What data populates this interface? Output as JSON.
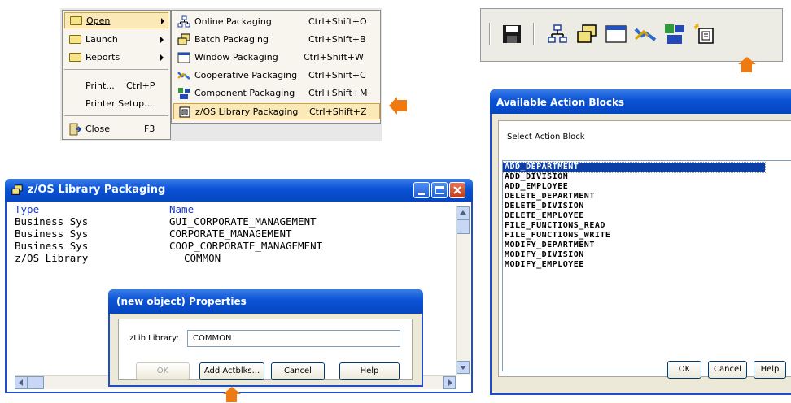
{
  "colors": {
    "accent_orange": "#f07a12",
    "xp_title_blue": "#0a52d6",
    "selection_blue": "#0b3fa5",
    "menu_highlight": "#fbe9b7"
  },
  "file_menu": {
    "items": [
      {
        "label": "Open",
        "icon": "folder-icon",
        "submenu": true
      },
      {
        "label": "Launch",
        "icon": "folder-icon",
        "submenu": true
      },
      {
        "label": "Reports",
        "icon": "folder-icon",
        "submenu": true
      },
      {
        "label": "Print...",
        "shortcut": "Ctrl+P"
      },
      {
        "label": "Printer Setup..."
      },
      {
        "label": "Close",
        "shortcut": "F3",
        "icon": "close-door-icon"
      }
    ]
  },
  "open_submenu": {
    "items": [
      {
        "label": "Online Packaging",
        "shortcut": "Ctrl+Shift+O",
        "icon": "online-packaging-icon"
      },
      {
        "label": "Batch Packaging",
        "shortcut": "Ctrl+Shift+B",
        "icon": "batch-packaging-icon"
      },
      {
        "label": "Window Packaging",
        "shortcut": "Ctrl+Shift+W",
        "icon": "window-packaging-icon"
      },
      {
        "label": "Cooperative Packaging",
        "shortcut": "Ctrl+Shift+C",
        "icon": "cooperative-packaging-icon"
      },
      {
        "label": "Component Packaging",
        "shortcut": "Ctrl+Shift+M",
        "icon": "component-packaging-icon"
      },
      {
        "label": "z/OS Library Packaging",
        "shortcut": "Ctrl+Shift+Z",
        "icon": "zos-library-icon",
        "highlighted": true
      }
    ]
  },
  "toolbar": {
    "buttons": [
      "save-icon",
      "online-packaging-icon",
      "batch-packaging-icon",
      "window-packaging-icon",
      "cooperative-packaging-icon",
      "component-packaging-icon",
      "zos-library-icon"
    ]
  },
  "zos_window": {
    "title": "z/OS Library Packaging",
    "columns": [
      "Type",
      "Name"
    ],
    "rows": [
      [
        "Business Sys",
        "GUI_CORPORATE_MANAGEMENT"
      ],
      [
        "Business Sys",
        "CORPORATE_MANAGEMENT"
      ],
      [
        "Business Sys",
        "COOP_CORPORATE_MANAGEMENT"
      ],
      [
        "z/OS Library",
        "COMMON"
      ]
    ]
  },
  "properties_dialog": {
    "title": "(new object) Properties",
    "field_label": "zLib Library:",
    "field_value": "COMMON",
    "buttons": {
      "ok": "OK",
      "add": "Add Actblks...",
      "cancel": "Cancel",
      "help": "Help"
    }
  },
  "action_blocks_dialog": {
    "title": "Available Action Blocks",
    "prompt": "Select Action Block",
    "items": [
      "ADD_DEPARTMENT",
      "ADD_DIVISION",
      "ADD_EMPLOYEE",
      "DELETE_DEPARTMENT",
      "DELETE_DIVISION",
      "DELETE_EMPLOYEE",
      "FILE_FUNCTIONS_READ",
      "FILE_FUNCTIONS_WRITE",
      "MODIFY_DEPARTMENT",
      "MODIFY_DIVISION",
      "MODIFY_EMPLOYEE"
    ],
    "selected_index": 0,
    "buttons": {
      "ok": "OK",
      "cancel": "Cancel",
      "help": "Help"
    }
  }
}
